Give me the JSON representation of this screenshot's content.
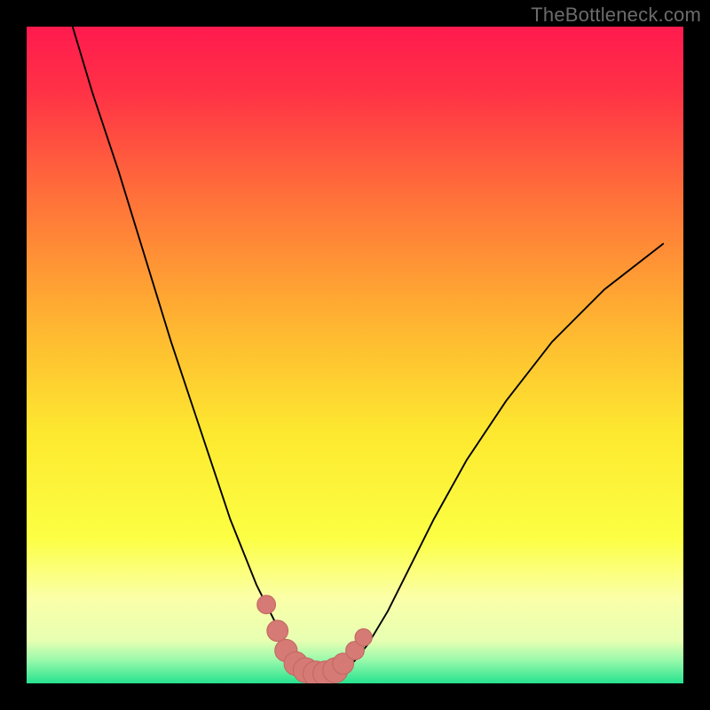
{
  "watermark": "TheBottleneck.com",
  "colors": {
    "black": "#000000",
    "curve": "#000000",
    "marker_fill": "#d57a75",
    "marker_stroke": "#c46864"
  },
  "chart_data": {
    "type": "line",
    "title": "",
    "xlabel": "",
    "ylabel": "",
    "xlim": [
      0,
      100
    ],
    "ylim": [
      0,
      100
    ],
    "background_gradient_stops": [
      {
        "offset": 0.0,
        "color": "#ff1a4e"
      },
      {
        "offset": 0.1,
        "color": "#ff3246"
      },
      {
        "offset": 0.25,
        "color": "#ff6d3a"
      },
      {
        "offset": 0.45,
        "color": "#ffb431"
      },
      {
        "offset": 0.62,
        "color": "#fde92f"
      },
      {
        "offset": 0.78,
        "color": "#fcff44"
      },
      {
        "offset": 0.87,
        "color": "#fbffa8"
      },
      {
        "offset": 0.935,
        "color": "#e7ffb2"
      },
      {
        "offset": 0.965,
        "color": "#98f9ab"
      },
      {
        "offset": 1.0,
        "color": "#27e28f"
      }
    ],
    "series": [
      {
        "name": "bottleneck-curve",
        "x": [
          7,
          10,
          14,
          18,
          22,
          26,
          29,
          31,
          33,
          35,
          37,
          38.5,
          40,
          41.5,
          43,
          45,
          47,
          48.5,
          50,
          52,
          55,
          58,
          62,
          67,
          73,
          80,
          88,
          97
        ],
        "y": [
          100,
          90,
          78,
          65,
          52,
          40,
          31,
          25,
          20,
          15,
          11,
          8,
          5,
          3,
          2,
          1.5,
          1.5,
          2,
          3.5,
          6,
          11,
          17,
          25,
          34,
          43,
          52,
          60,
          67
        ]
      }
    ],
    "markers": {
      "name": "highlight-range",
      "x": [
        36.5,
        38.2,
        39.5,
        41,
        42.5,
        44,
        45.5,
        47,
        48.2,
        50,
        51.3
      ],
      "y": [
        12,
        8,
        5,
        3,
        2,
        1.5,
        1.5,
        2,
        3,
        5,
        7
      ],
      "r": [
        1.4,
        1.6,
        1.7,
        1.8,
        1.9,
        1.9,
        1.9,
        1.9,
        1.6,
        1.4,
        1.3
      ]
    }
  }
}
